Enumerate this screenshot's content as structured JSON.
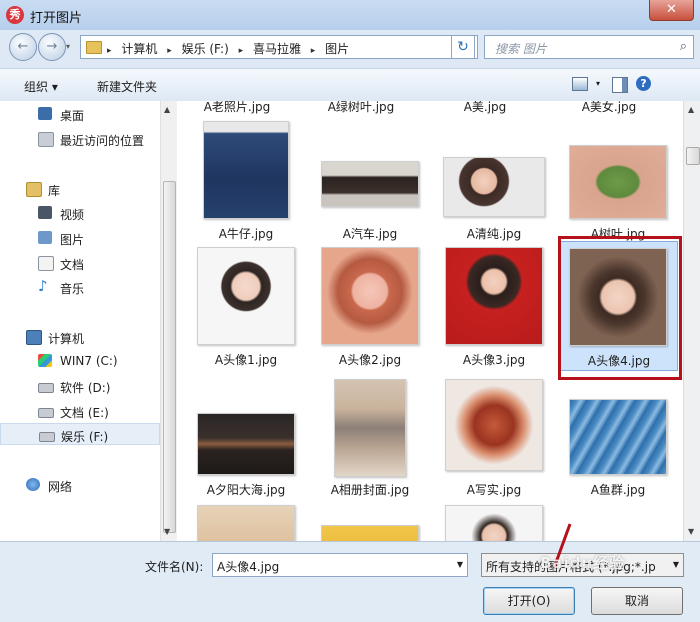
{
  "window": {
    "title": "打开图片",
    "app_icon_glyph": "秀",
    "close_glyph": "✕"
  },
  "nav": {
    "back_glyph": "←",
    "forward_glyph": "→",
    "history_glyph": "▾",
    "breadcrumbs": [
      "计算机",
      "娱乐 (F:)",
      "喜马拉雅",
      "图片"
    ],
    "separator": "▸",
    "refresh_glyph": "↻",
    "search_placeholder": "搜索 图片"
  },
  "toolbar": {
    "organize": "组织 ▾",
    "new_folder": "新建文件夹",
    "help_glyph": "?"
  },
  "sidebar": {
    "items": [
      {
        "label": "桌面",
        "icon": "desktop-icon"
      },
      {
        "label": "最近访问的位置",
        "icon": "recent-places-icon"
      },
      {
        "label": "库",
        "icon": "library-icon"
      },
      {
        "label": "视频",
        "icon": "video-library-icon"
      },
      {
        "label": "图片",
        "icon": "pictures-library-icon"
      },
      {
        "label": "文档",
        "icon": "documents-library-icon"
      },
      {
        "label": "音乐",
        "icon": "music-library-icon"
      },
      {
        "label": "计算机",
        "icon": "computer-icon"
      },
      {
        "label": "WIN7 (C:)",
        "icon": "system-drive-icon"
      },
      {
        "label": "软件 (D:)",
        "icon": "drive-icon"
      },
      {
        "label": "文档 (E:)",
        "icon": "drive-icon"
      },
      {
        "label": "娱乐 (F:)",
        "icon": "drive-icon",
        "selected": true
      },
      {
        "label": "网络",
        "icon": "network-icon"
      }
    ]
  },
  "files": [
    {
      "name": "A老照片.jpg"
    },
    {
      "name": "A绿树叶.jpg"
    },
    {
      "name": "A美.jpg"
    },
    {
      "name": "A美女.jpg"
    },
    {
      "name": "A牛仔.jpg"
    },
    {
      "name": "A汽车.jpg"
    },
    {
      "name": "A清纯.jpg"
    },
    {
      "name": "A树叶.jpg"
    },
    {
      "name": "A头像1.jpg"
    },
    {
      "name": "A头像2.jpg"
    },
    {
      "name": "A头像3.jpg"
    },
    {
      "name": "A头像4.jpg",
      "selected": true
    },
    {
      "name": "A夕阳大海.jpg"
    },
    {
      "name": "A相册封面.jpg"
    },
    {
      "name": "A写实.jpg"
    },
    {
      "name": "A鱼群.jpg"
    }
  ],
  "bottom": {
    "filename_label": "文件名(N):",
    "filename_value": "A头像4.jpg",
    "filter_value": "所有支持的图片格式 (*.jpg;*.jp",
    "open_button": "打开(O)",
    "cancel_button": "取消"
  },
  "watermark": "Baidu经验",
  "colors": {
    "highlight": "#b5111b",
    "selection": "#cde3fb"
  }
}
